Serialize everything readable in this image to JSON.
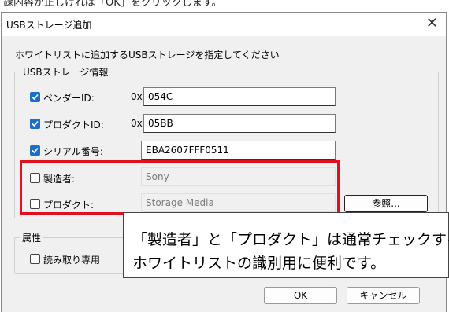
{
  "background_text": "録内容が正しければ「OK」をクリックします。",
  "dialog": {
    "title": "USBストレージ追加",
    "instruction": "ホワイトリストに追加するUSBストレージを指定してください",
    "info_group": {
      "label": "USBストレージ情報",
      "fields": [
        {
          "label": "ベンダーID:",
          "prefix": "0x",
          "value": "054C",
          "checked": true
        },
        {
          "label": "プロダクトID:",
          "prefix": "0x",
          "value": "05BB",
          "checked": true
        },
        {
          "label": "シリアル番号:",
          "prefix": "",
          "value": "EBA2607FFF0511",
          "checked": true
        },
        {
          "label": "製造者:",
          "prefix": "",
          "value": "Sony",
          "checked": false
        },
        {
          "label": "プロダクト:",
          "prefix": "",
          "value": "Storage Media",
          "checked": false
        }
      ],
      "browse_button": "参照..."
    },
    "attr_group": {
      "label": "属性",
      "readonly_label": "読み取り専用",
      "readonly_checked": false
    },
    "ok_button": "OK",
    "cancel_button": "キャンセル"
  },
  "callout": {
    "line1": "「製造者」と「プロダクト」は通常チェックする",
    "line2": "ホワイトリストの識別用に便利です。"
  },
  "colors": {
    "highlight": "#e01020",
    "checkbox": "#1b6fc8"
  }
}
